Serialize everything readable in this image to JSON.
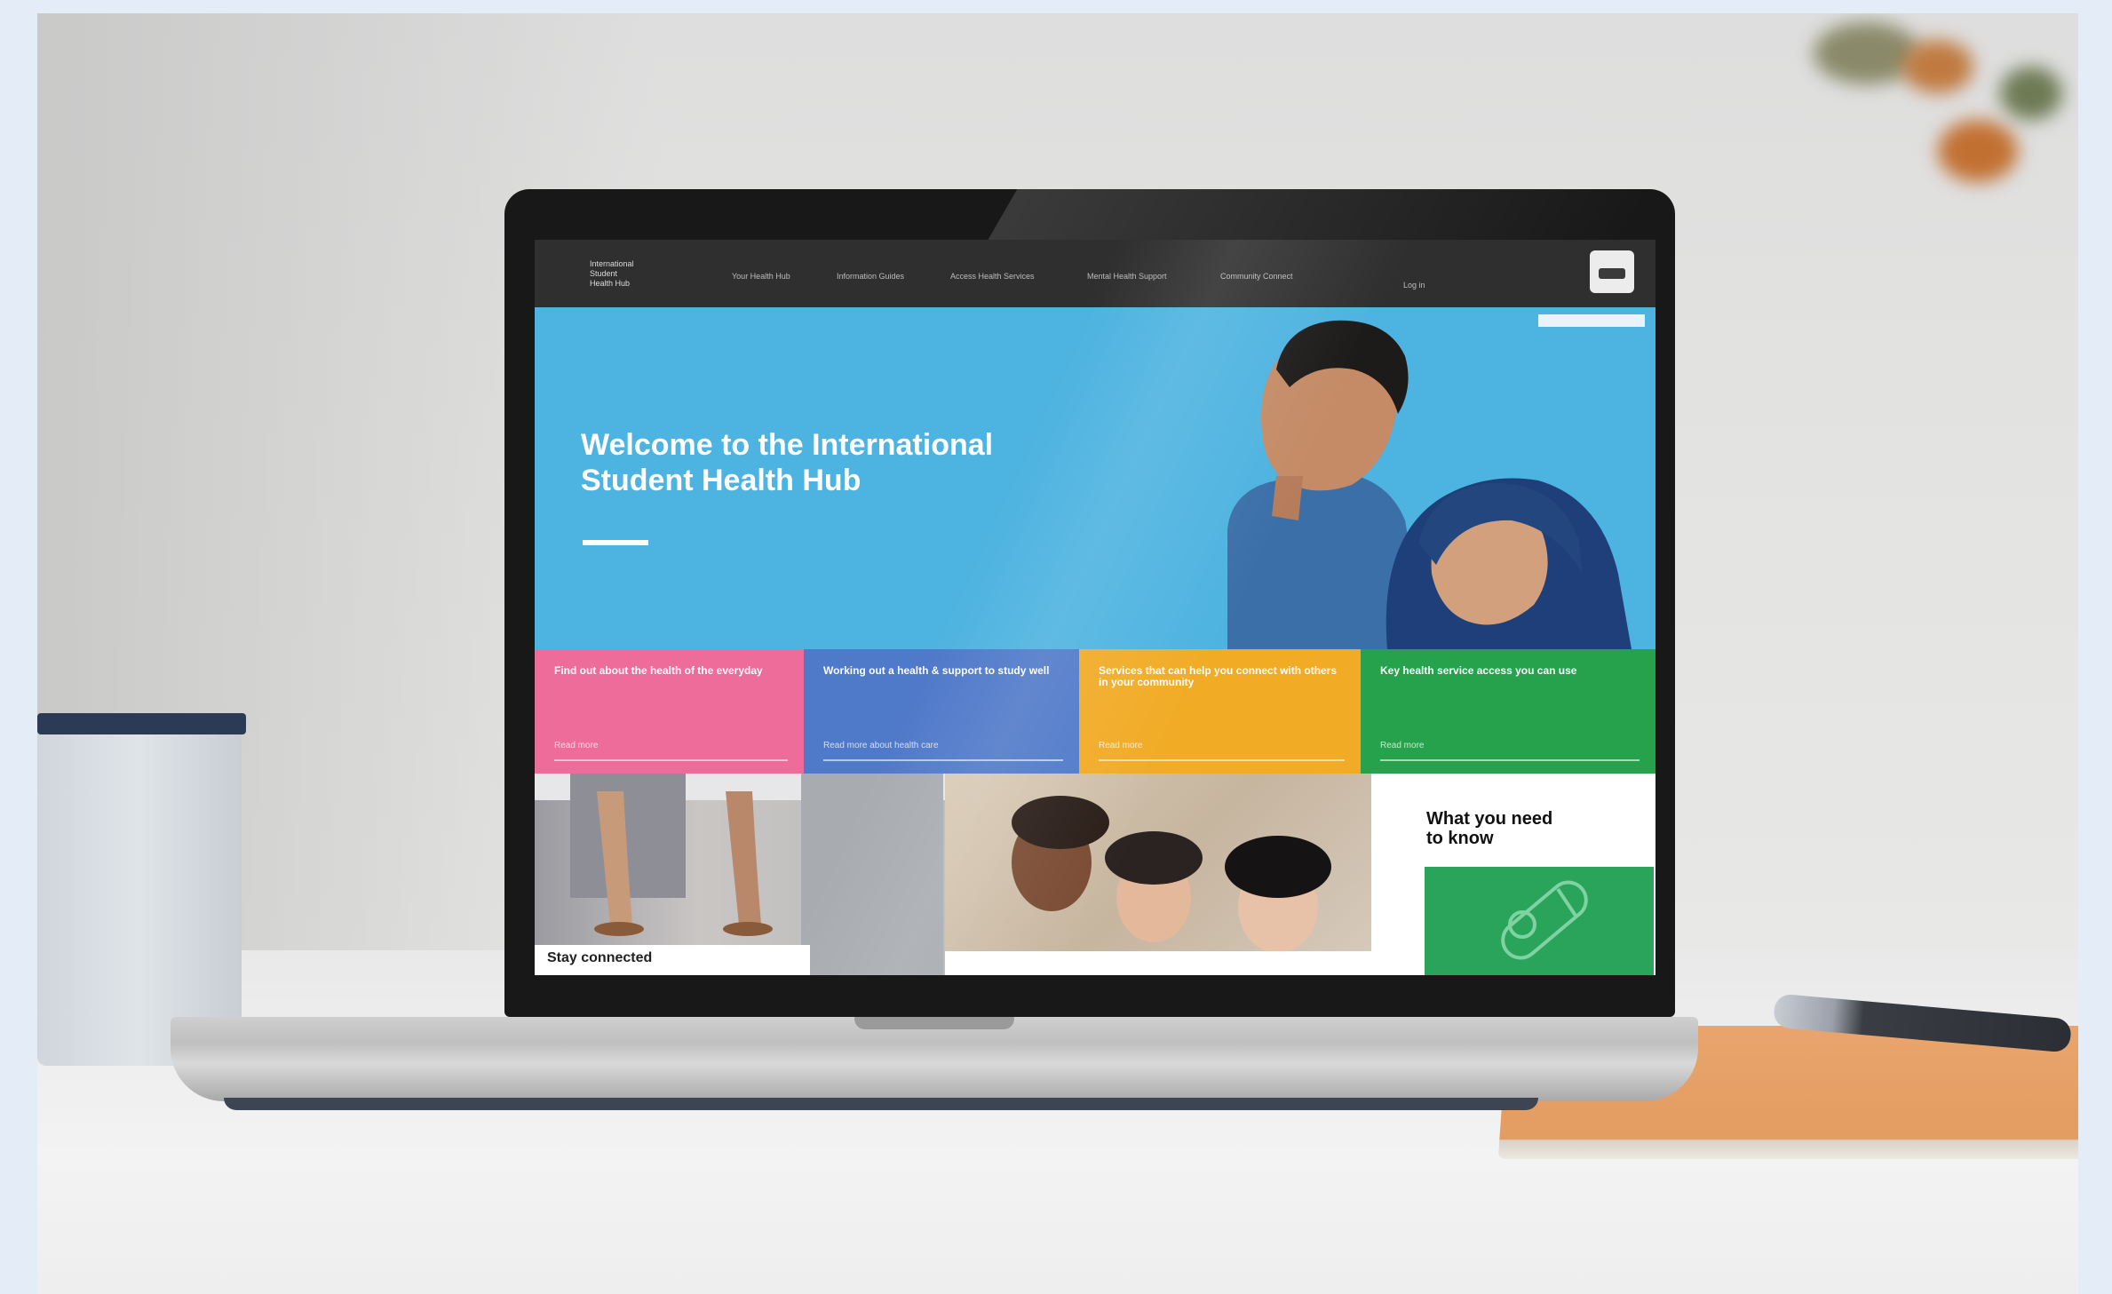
{
  "site": {
    "brand_lines": [
      "International",
      "Student",
      "Health Hub"
    ],
    "nav_items": [
      {
        "label": "Your Health Hub"
      },
      {
        "label": "Information Guides"
      },
      {
        "label": "Access Health Services"
      },
      {
        "label": "Mental Health Support"
      },
      {
        "label": "Community Connect"
      }
    ],
    "login_label": "Log in"
  },
  "hero": {
    "title": "Welcome to the International Student Health Hub",
    "accent_color": "#4db3e0"
  },
  "tiles": [
    {
      "title": "Find out about the health of the everyday",
      "link": "Read more",
      "color": "#ee6c99"
    },
    {
      "title": "Working out a health & support to study well",
      "link": "Read more about health care",
      "color": "#4f79c9"
    },
    {
      "title": "Services that can help you connect with others in your community",
      "link": "Read more",
      "color": "#f1ab25"
    },
    {
      "title": "Key health service access you can use",
      "link": "Read more",
      "color": "#26a24c"
    }
  ],
  "cards": {
    "photo_a_caption": "Stay connected",
    "photo_b_caption": "",
    "know_title": "What you need to know"
  },
  "colors": {
    "nav_bg": "#2f2f2f",
    "know_green": "#2aa35b"
  }
}
